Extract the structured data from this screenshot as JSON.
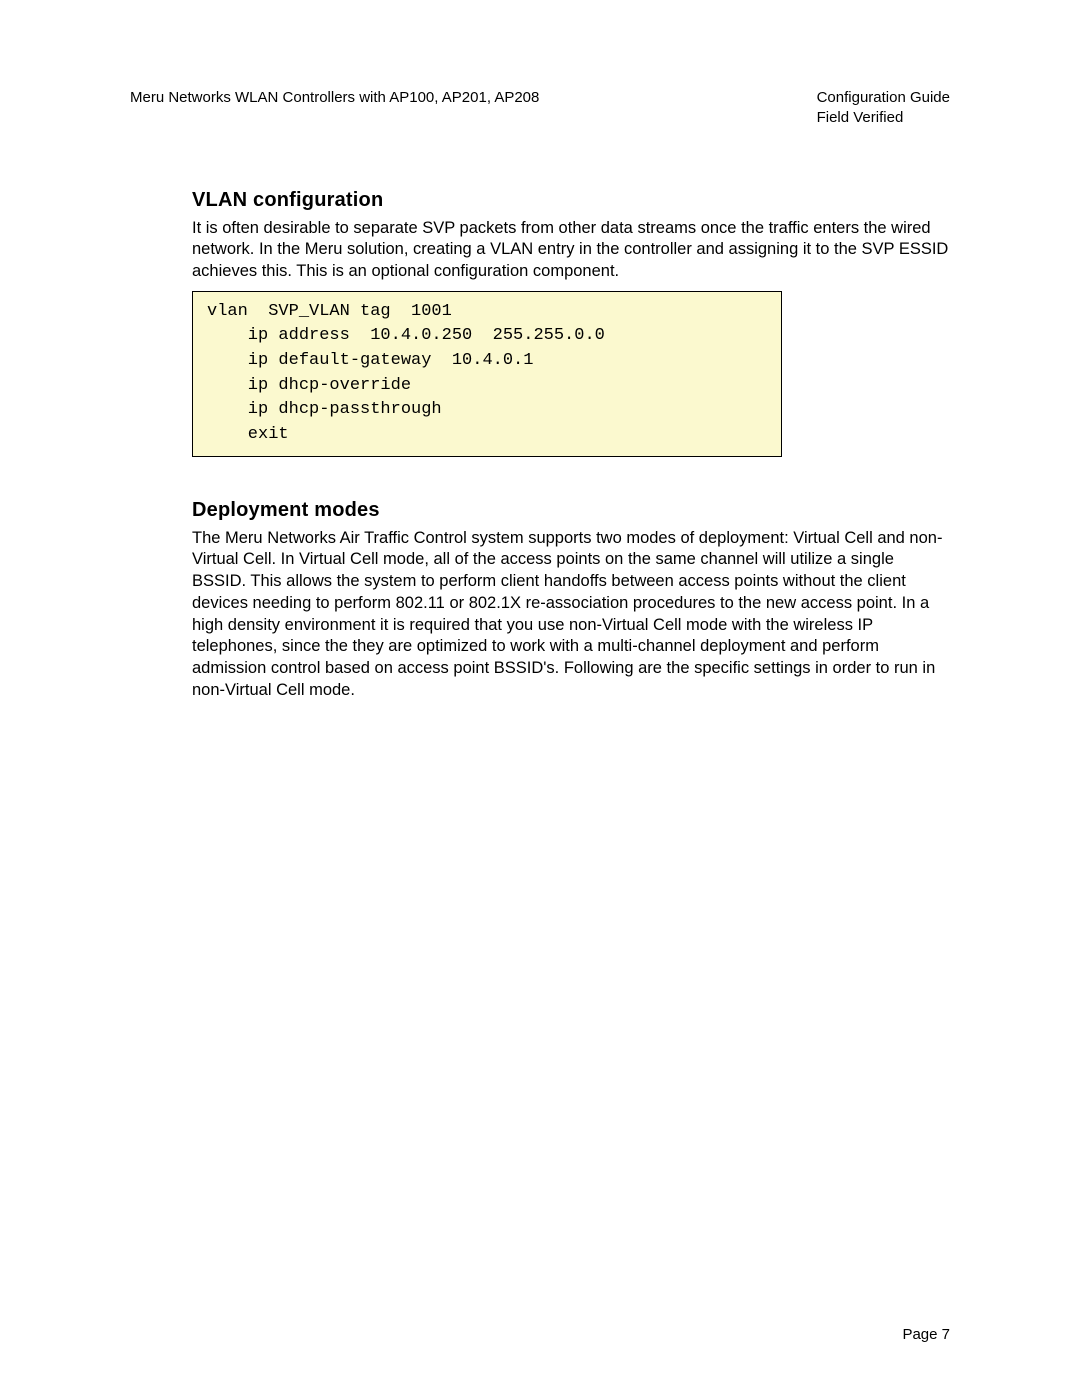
{
  "header": {
    "left": "Meru Networks WLAN Controllers with AP100, AP201, AP208",
    "right_line1": "Configuration Guide",
    "right_line2": "Field Verified"
  },
  "sections": {
    "vlan": {
      "title": "VLAN configuration",
      "body": "It is often desirable to separate SVP packets from other data streams once the traffic enters the wired network. In the Meru solution, creating a VLAN entry in the controller and assigning it to the SVP ESSID achieves this. This is an optional configuration component.",
      "code": "vlan  SVP_VLAN tag  1001\n    ip address  10.4.0.250  255.255.0.0\n    ip default-gateway  10.4.0.1\n    ip dhcp-override\n    ip dhcp-passthrough\n    exit"
    },
    "deploy": {
      "title": "Deployment modes",
      "body": "The Meru Networks Air Traffic Control system supports two modes of deployment: Virtual Cell and non-Virtual Cell. In Virtual Cell mode, all of the access points on the same channel will utilize a single BSSID. This allows the system to perform client handoffs between access points without the client devices needing to perform 802.11 or 802.1X re-association procedures to the new access point. In a high density environment it is required that you use non-Virtual Cell mode with the wireless IP telephones, since the they are optimized to work with a multi-channel deployment and perform admission control based on access point BSSID's. Following are the specific settings in order to run in non-Virtual Cell mode."
    }
  },
  "footer": {
    "page_label": "Page 7"
  }
}
